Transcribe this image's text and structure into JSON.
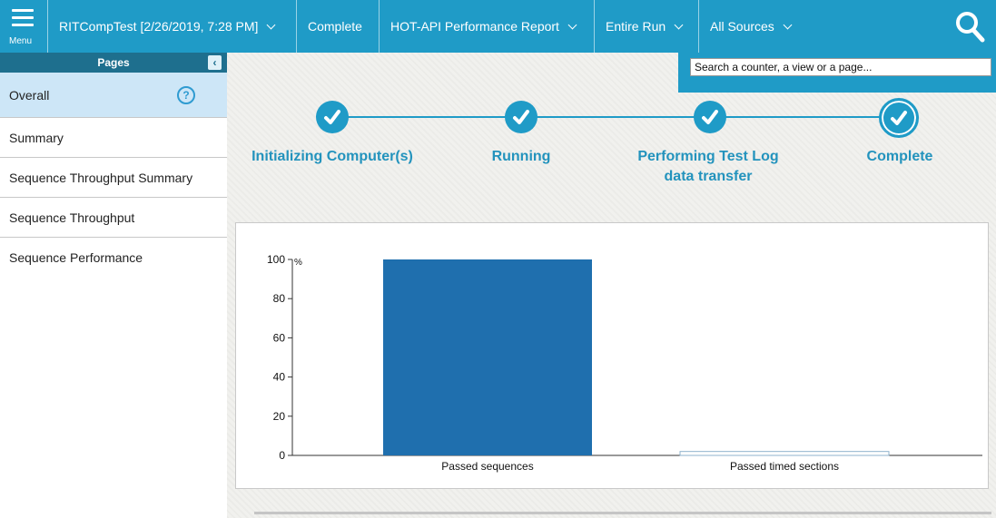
{
  "toolbar": {
    "menu_label": "Menu",
    "test_selector": "RITCompTest [2/26/2019, 7:28 PM]",
    "status": "Complete",
    "report": "HOT-API Performance Report",
    "range": "Entire Run",
    "sources": "All Sources"
  },
  "search": {
    "placeholder": "Search a counter, a view or a page..."
  },
  "pages": {
    "title": "Pages",
    "collapse_glyph": "‹",
    "help_glyph": "?",
    "items": [
      {
        "label": "Overall",
        "active": true
      },
      {
        "label": "Summary"
      },
      {
        "label": "Sequence Throughput Summary"
      },
      {
        "label": "Sequence Throughput"
      },
      {
        "label": "Sequence Performance"
      }
    ]
  },
  "steps": {
    "check_glyph": "✔",
    "items": [
      {
        "label": "Initializing Computer(s)"
      },
      {
        "label": "Running"
      },
      {
        "label": "Performing Test Log data transfer"
      },
      {
        "label": "Complete",
        "current": true
      }
    ]
  },
  "colors": {
    "accent": "#1f9bc7",
    "bar": "#1f6fae",
    "sidebar_active": "#cde6f7"
  },
  "chart_data": {
    "type": "bar",
    "categories": [
      "Passed sequences",
      "Passed timed sections"
    ],
    "values": [
      100,
      2
    ],
    "ylim": [
      0,
      100
    ],
    "yticks": [
      0,
      20,
      40,
      60,
      80,
      100
    ],
    "unit_label": "%"
  }
}
